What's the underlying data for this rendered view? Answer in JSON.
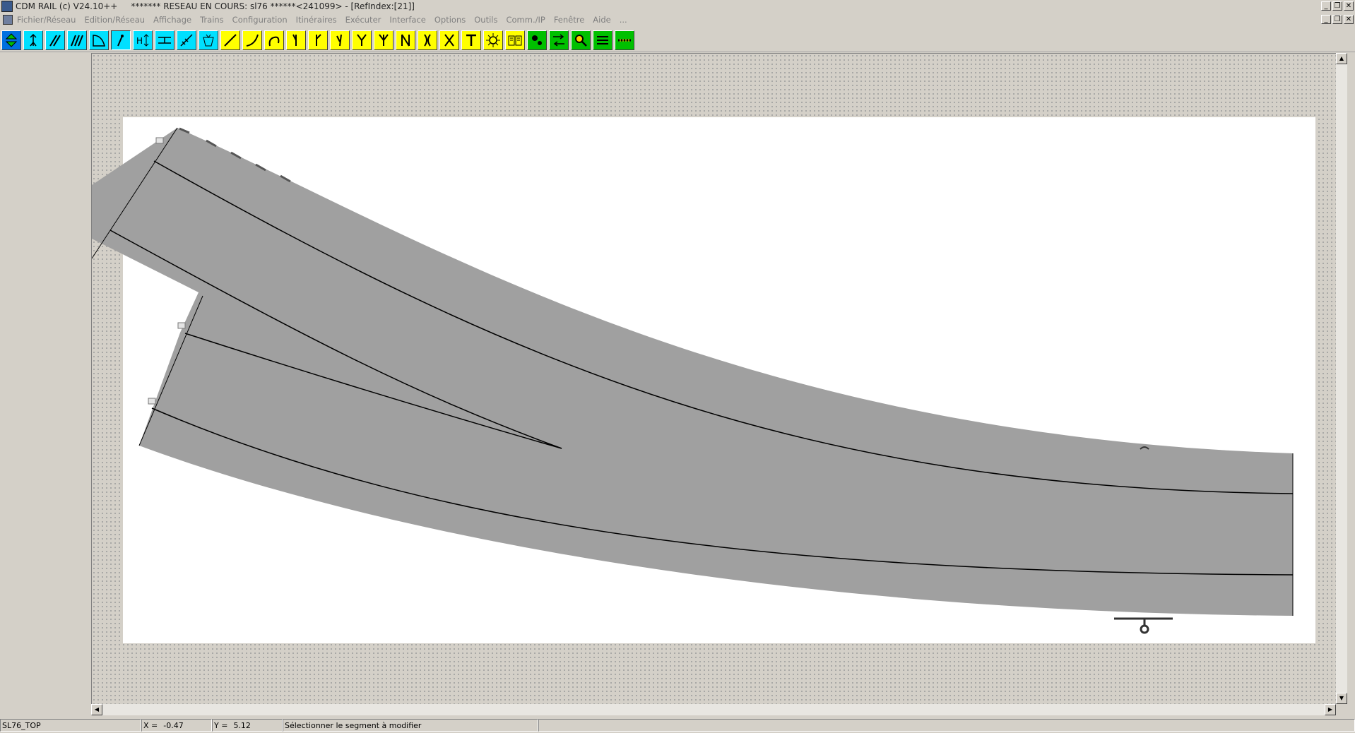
{
  "window": {
    "title": "CDM RAIL (c) V24.10++     ******* RESEAU EN COURS: sl76 ******<241099> - [RefIndex:[21]]"
  },
  "menu": {
    "items": [
      "Fichier/Réseau",
      "Edition/Réseau",
      "Affichage",
      "Trains",
      "Configuration",
      "Itinéraires",
      "Exécuter",
      "Interface",
      "Options",
      "Outils",
      "Comm./IP",
      "Fenêtre",
      "Aide",
      "..."
    ]
  },
  "toolbar": {
    "tools": [
      {
        "name": "select-mode-icon",
        "bg": "#0070e0"
      },
      {
        "name": "person-icon",
        "bg": "#00e0ff"
      },
      {
        "name": "track-edit-icon",
        "bg": "#00e0ff"
      },
      {
        "name": "double-track-icon",
        "bg": "#00e0ff"
      },
      {
        "name": "curve-segment-icon",
        "bg": "#00e0ff"
      },
      {
        "name": "point-select-icon",
        "bg": "#00e0ff",
        "pressed": true
      },
      {
        "name": "height-icon",
        "bg": "#00e0ff"
      },
      {
        "name": "bridge-icon",
        "bg": "#00e0ff"
      },
      {
        "name": "measure-icon",
        "bg": "#00e0ff"
      },
      {
        "name": "basket-icon",
        "bg": "#00e0ff"
      },
      {
        "name": "straight-track-icon",
        "bg": "#ffff00"
      },
      {
        "name": "curved-track-icon",
        "bg": "#ffff00"
      },
      {
        "name": "flex-track-icon",
        "bg": "#ffff00"
      },
      {
        "name": "left-turnout-icon",
        "bg": "#ffff00"
      },
      {
        "name": "right-turnout-icon",
        "bg": "#ffff00"
      },
      {
        "name": "curved-turnout-icon",
        "bg": "#ffff00"
      },
      {
        "name": "wye-turnout-icon",
        "bg": "#ffff00"
      },
      {
        "name": "three-way-turnout-icon",
        "bg": "#ffff00"
      },
      {
        "name": "double-slip-icon",
        "bg": "#ffff00"
      },
      {
        "name": "single-slip-icon",
        "bg": "#ffff00"
      },
      {
        "name": "crossing-icon",
        "bg": "#ffff00"
      },
      {
        "name": "turntable-icon",
        "bg": "#ffff00"
      },
      {
        "name": "gear-sun-icon",
        "bg": "#ffff00"
      },
      {
        "name": "book-icon",
        "bg": "#ffff00"
      },
      {
        "name": "settings-gears-icon",
        "bg": "#00c000"
      },
      {
        "name": "transfer-icon",
        "bg": "#00c000"
      },
      {
        "name": "search-icon",
        "bg": "#00c000"
      },
      {
        "name": "lines-icon",
        "bg": "#00c000"
      },
      {
        "name": "ruler-icon",
        "bg": "#00c000"
      }
    ]
  },
  "colors": {
    "track_fill": "#a0a0a0",
    "rail_line": "#000000",
    "sheet": "#ffffff"
  },
  "status": {
    "part_name": "SL76_TOP",
    "x_label": "X =",
    "x_value": "-0.47",
    "y_label": "Y =",
    "y_value": "5.12",
    "message": "Sélectionner le segment à modifier"
  }
}
